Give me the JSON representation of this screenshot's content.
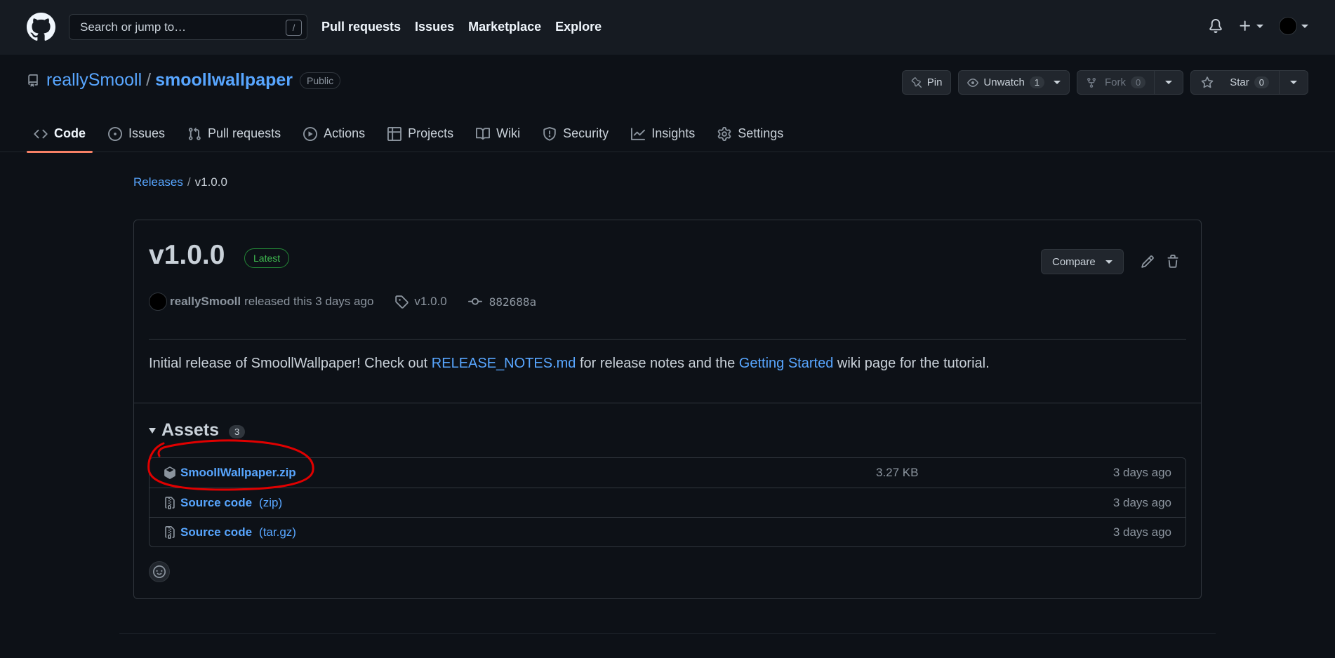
{
  "header": {
    "search_placeholder": "Search or jump to…",
    "search_shortcut": "/",
    "nav": [
      "Pull requests",
      "Issues",
      "Marketplace",
      "Explore"
    ]
  },
  "repo": {
    "owner": "reallySmooll",
    "separator": "/",
    "name": "smoollwallpaper",
    "visibility": "Public",
    "pin_label": "Pin",
    "unwatch_label": "Unwatch",
    "watch_count": "1",
    "fork_label": "Fork",
    "fork_count": "0",
    "star_label": "Star",
    "star_count": "0"
  },
  "tabs": [
    {
      "label": "Code",
      "icon": "code-icon"
    },
    {
      "label": "Issues",
      "icon": "issue-icon"
    },
    {
      "label": "Pull requests",
      "icon": "pull-request-icon"
    },
    {
      "label": "Actions",
      "icon": "play-icon"
    },
    {
      "label": "Projects",
      "icon": "table-icon"
    },
    {
      "label": "Wiki",
      "icon": "book-icon"
    },
    {
      "label": "Security",
      "icon": "shield-icon"
    },
    {
      "label": "Insights",
      "icon": "graph-icon"
    },
    {
      "label": "Settings",
      "icon": "gear-icon"
    }
  ],
  "breadcrumb": {
    "releases": "Releases",
    "sep": "/",
    "current": "v1.0.0"
  },
  "release": {
    "title": "v1.0.0",
    "badge": "Latest",
    "compare_label": "Compare",
    "author": "reallySmooll",
    "released_text": "released this 3 days ago",
    "tag": "v1.0.0",
    "commit": "882688a",
    "body": {
      "part1": "Initial release of SmoollWallpaper! Check out ",
      "link1": "RELEASE_NOTES.md",
      "part2": " for release notes and the ",
      "link2": "Getting Started",
      "part3": " wiki page for the tutorial."
    },
    "assets_label": "Assets",
    "assets_count": "3",
    "assets": [
      {
        "name": "SmoollWallpaper.zip",
        "suffix": "",
        "size": "3.27 KB",
        "date": "3 days ago",
        "icon": "package-icon"
      },
      {
        "name": "Source code",
        "suffix": "(zip)",
        "size": "",
        "date": "3 days ago",
        "icon": "file-zip-icon"
      },
      {
        "name": "Source code",
        "suffix": "(tar.gz)",
        "size": "",
        "date": "3 days ago",
        "icon": "file-zip-icon"
      }
    ]
  },
  "colors": {
    "accent": "#58a6ff",
    "tab_underline": "#f78166",
    "latest": "#3fb950",
    "annotation": "#e00000"
  }
}
